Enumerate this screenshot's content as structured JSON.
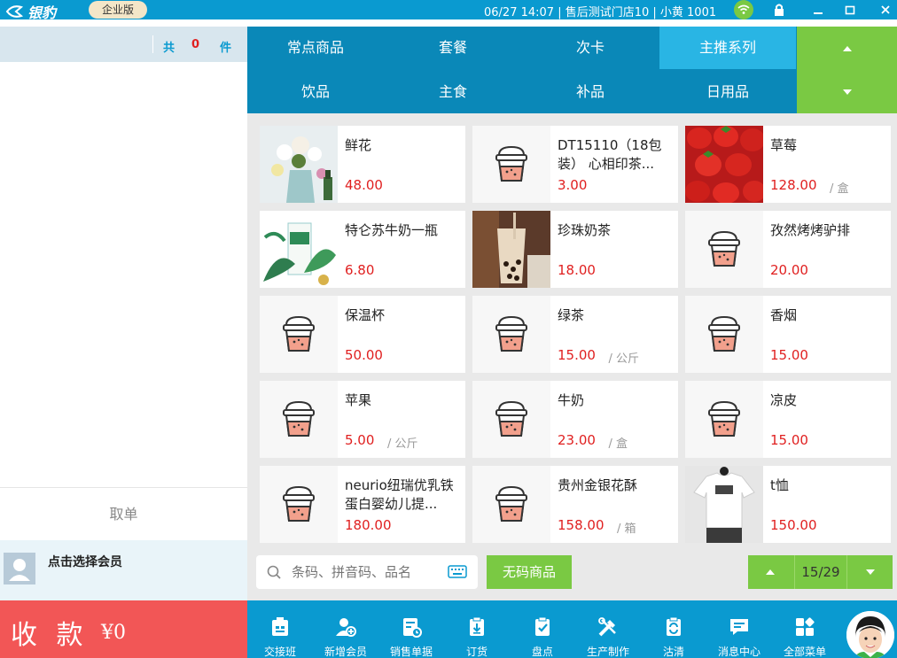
{
  "titlebar": {
    "app_name": "银豹",
    "edition": "企业版",
    "info": "06/27 14:07 | 售后测试门店10 | 小黄 1001"
  },
  "cart": {
    "total_prefix": "共",
    "count": "0",
    "unit": "件",
    "cancel_label": "取单",
    "member_label": "点击选择会员",
    "checkout_label": "收 款",
    "checkout_amount": "¥0"
  },
  "categories": [
    {
      "label": "常点商品"
    },
    {
      "label": "套餐"
    },
    {
      "label": "次卡"
    },
    {
      "label": "主推系列",
      "active": true
    },
    {
      "label": "饮品"
    },
    {
      "label": "主食"
    },
    {
      "label": "补品"
    },
    {
      "label": "日用品"
    }
  ],
  "products": [
    {
      "name": "鲜花",
      "price": "48.00",
      "unit": "",
      "image": "flowers"
    },
    {
      "name": "DT15110（18包装） 心相印茶...",
      "price": "3.00",
      "unit": "",
      "image": "cup-icon"
    },
    {
      "name": "草莓",
      "price": "128.00",
      "unit": "/ 盒",
      "image": "strawberries"
    },
    {
      "name": "特仑苏牛奶一瓶",
      "price": "6.80",
      "unit": "",
      "image": "milk-bottle"
    },
    {
      "name": "珍珠奶茶",
      "price": "18.00",
      "unit": "",
      "image": "bubble-tea"
    },
    {
      "name": "孜然烤烤驴排",
      "price": "20.00",
      "unit": "",
      "image": "cup-icon"
    },
    {
      "name": "保温杯",
      "price": "50.00",
      "unit": "",
      "image": "cup-icon"
    },
    {
      "name": "绿茶",
      "price": "15.00",
      "unit": "/ 公斤",
      "image": "cup-icon"
    },
    {
      "name": "香烟",
      "price": "15.00",
      "unit": "",
      "image": "cup-icon"
    },
    {
      "name": "苹果",
      "price": "5.00",
      "unit": "/ 公斤",
      "image": "cup-icon"
    },
    {
      "name": "牛奶",
      "price": "23.00",
      "unit": "/ 盒",
      "image": "cup-icon"
    },
    {
      "name": "凉皮",
      "price": "15.00",
      "unit": "",
      "image": "cup-icon"
    },
    {
      "name": "neurio纽瑞优乳铁蛋白婴幼儿提...",
      "price": "180.00",
      "unit": "",
      "image": "cup-icon"
    },
    {
      "name": "贵州金银花酥",
      "price": "158.00",
      "unit": "/ 箱",
      "image": "cup-icon"
    },
    {
      "name": "t恤",
      "price": "150.00",
      "unit": "",
      "image": "tshirt"
    }
  ],
  "search": {
    "placeholder": "条码、拼音码、品名",
    "nocode_label": "无码商品"
  },
  "pager": {
    "page": "15/29"
  },
  "toolbar": [
    {
      "label": "交接班",
      "icon": "handover-icon"
    },
    {
      "label": "新增会员",
      "icon": "add-member-icon"
    },
    {
      "label": "销售单据",
      "icon": "sales-docs-icon"
    },
    {
      "label": "订货",
      "icon": "order-icon"
    },
    {
      "label": "盘点",
      "icon": "inventory-icon"
    },
    {
      "label": "生产制作",
      "icon": "production-icon"
    },
    {
      "label": "沽清",
      "icon": "soldout-icon"
    },
    {
      "label": "消息中心",
      "icon": "message-icon"
    },
    {
      "label": "全部菜单",
      "icon": "all-menu-icon"
    }
  ],
  "colors": {
    "primary": "#0a9ad0",
    "accent_green": "#7ac943",
    "price_red": "#e02020",
    "checkout_red": "#f25656"
  }
}
